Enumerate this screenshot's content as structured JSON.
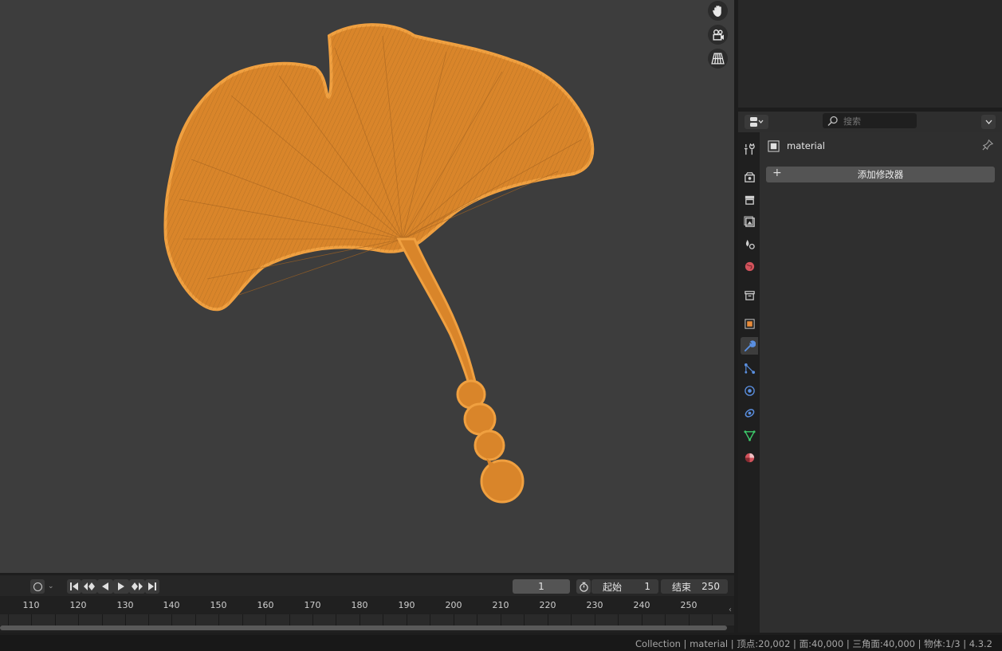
{
  "viewport": {
    "object_name": "material",
    "tools": [
      {
        "icon": "hand-pan-icon"
      },
      {
        "icon": "camera-view-icon"
      },
      {
        "icon": "perspective-grid-icon"
      }
    ]
  },
  "timeline": {
    "current_frame": "1",
    "start_label": "起始",
    "start_value": "1",
    "end_label": "结束",
    "end_value": "250",
    "ruler": [
      "110",
      "120",
      "130",
      "140",
      "150",
      "160",
      "170",
      "180",
      "190",
      "200",
      "210",
      "220",
      "230",
      "240",
      "250"
    ]
  },
  "properties": {
    "search_placeholder": "搜索",
    "object_name": "material",
    "add_modifier_label": "添加修改器",
    "tabs": [
      {
        "icon": "tool-icon",
        "color": "#cfcfcf"
      },
      {
        "icon": "render-icon",
        "color": "#cfcfcf"
      },
      {
        "icon": "output-icon",
        "color": "#cfcfcf"
      },
      {
        "icon": "view-layer-icon",
        "color": "#cfcfcf"
      },
      {
        "icon": "scene-icon",
        "color": "#cfcfcf"
      },
      {
        "icon": "world-icon",
        "color": "#d2535c"
      },
      {
        "icon": "collection-icon",
        "color": "#cfcfcf"
      },
      {
        "icon": "object-icon",
        "color": "#e98c3a"
      },
      {
        "icon": "modifier-icon",
        "color": "#5a8fe0"
      },
      {
        "icon": "particles-icon",
        "color": "#5a8fe0"
      },
      {
        "icon": "physics-icon",
        "color": "#5a8fe0"
      },
      {
        "icon": "constraints-icon",
        "color": "#5a8fe0"
      },
      {
        "icon": "data-icon",
        "color": "#3dc96a"
      },
      {
        "icon": "material-icon",
        "color": "#d2535c"
      }
    ]
  },
  "status": {
    "text": "Collection | material | 顶点:20,002 | 面:40,000 | 三角面:40,000 | 物体:1/3 | 4.3.2"
  },
  "colors": {
    "accent_orange": "#e98c3a",
    "leaf_fill": "#d9852a",
    "leaf_edge": "#f0a040",
    "viewport_bg": "#3d3d3d"
  }
}
